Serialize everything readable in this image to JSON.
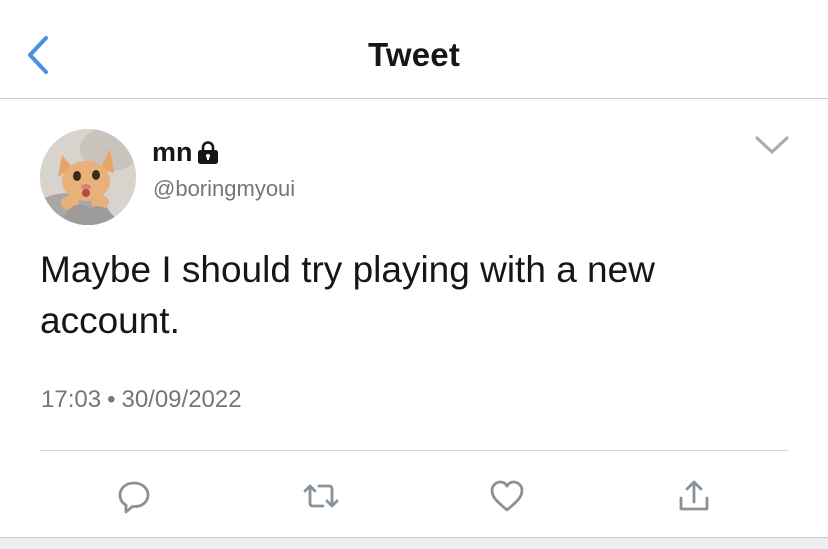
{
  "header": {
    "title": "Tweet",
    "back_icon": "chevron-left-icon"
  },
  "tweet": {
    "author": {
      "display_name": "mn",
      "handle": "@boringmyoui",
      "protected_icon": "lock-icon",
      "avatar": "cat-avatar"
    },
    "text": "Maybe I should try playing with a new account.",
    "time": "17:03",
    "separator": "•",
    "date": "30/09/2022"
  },
  "actions": [
    {
      "name": "reply",
      "icon": "reply-icon"
    },
    {
      "name": "retweet",
      "icon": "retweet-icon"
    },
    {
      "name": "like",
      "icon": "heart-icon"
    },
    {
      "name": "share",
      "icon": "share-icon"
    }
  ],
  "colors": {
    "accent": "#4a90e2",
    "text": "#14171a",
    "muted": "#70777d",
    "icon": "#8a9299"
  }
}
